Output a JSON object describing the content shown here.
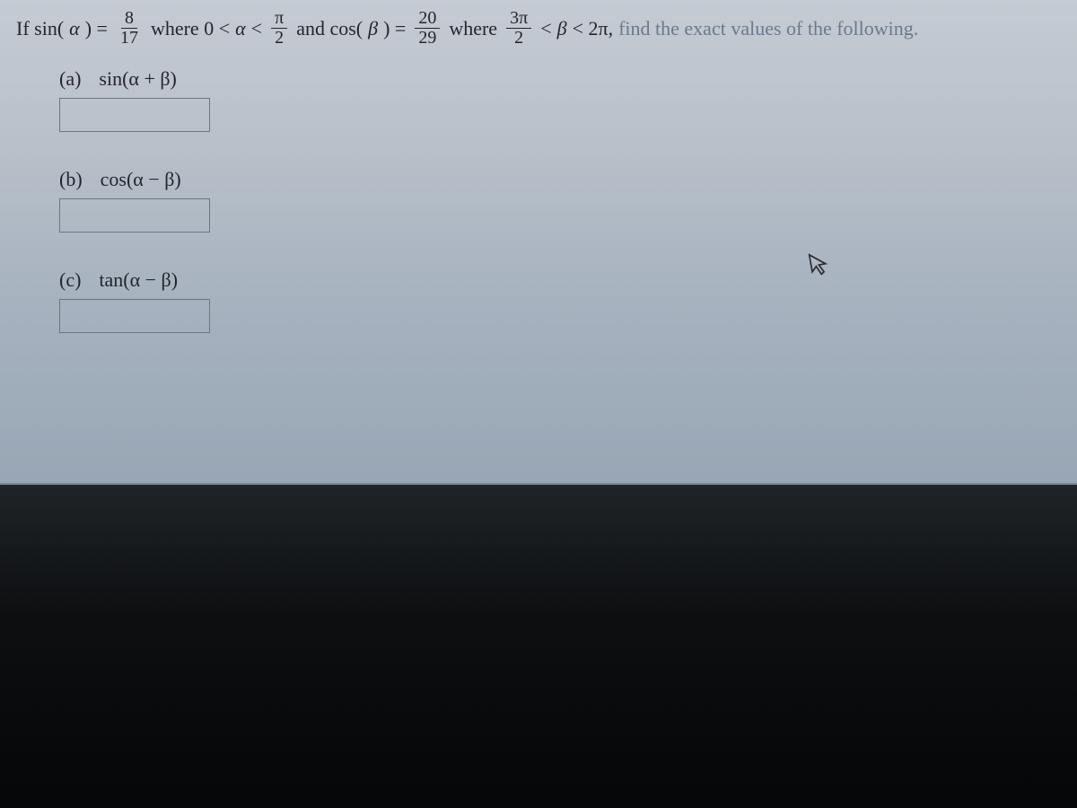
{
  "question": {
    "prefix": "If sin(",
    "var_alpha": "α",
    "eq1": ") = ",
    "frac1_num": "8",
    "frac1_den": "17",
    "where1": " where 0 < ",
    "lt1": " < ",
    "frac2_num": "π",
    "frac2_den": "2",
    "and_cos": " and cos(",
    "var_beta": "β",
    "eq2": ") = ",
    "frac3_num": "20",
    "frac3_den": "29",
    "where2": " where ",
    "frac4_num": "3π",
    "frac4_den": "2",
    "lt2": " < ",
    "lt3": " < 2π, ",
    "tail": "find the exact values of the following."
  },
  "parts": {
    "a": {
      "label": "(a)",
      "expr": "sin(α + β)"
    },
    "b": {
      "label": "(b)",
      "expr": "cos(α − β)"
    },
    "c": {
      "label": "(c)",
      "expr": "tan(α − β)"
    }
  }
}
